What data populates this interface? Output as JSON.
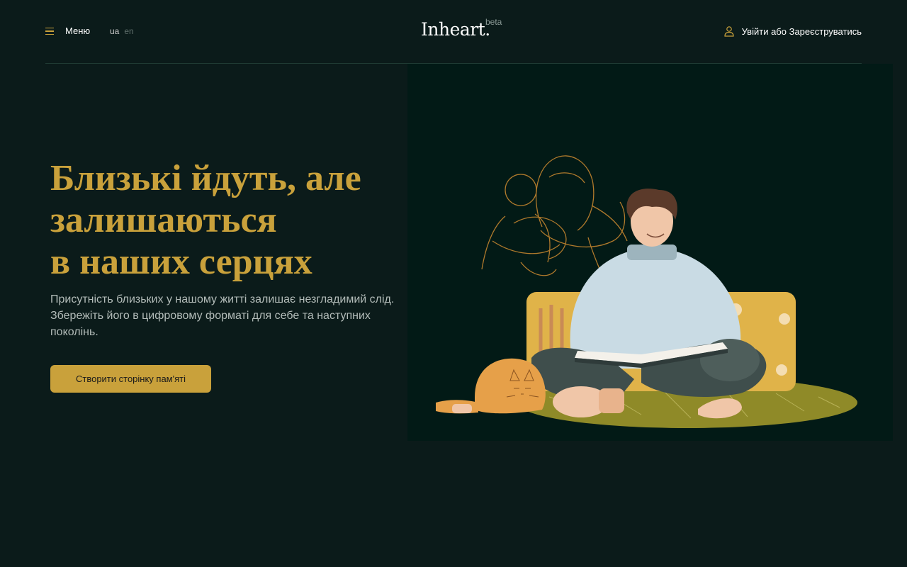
{
  "header": {
    "menu_label": "Меню",
    "lang_active": "ua",
    "lang_other": "en",
    "logo": "Inheart.",
    "beta": "beta",
    "auth_label": "Увійти або Зареєструватись"
  },
  "hero": {
    "title_lines": [
      "Близькі йдуть, але",
      "залишаються",
      "в наших серцях"
    ],
    "description": "Присутність близьких у нашому житті залишає незгладимий слід. Збережіть його в цифровому форматі для себе та наступних поколінь.",
    "cta_label": "Створити сторінку пам'яті"
  },
  "colors": {
    "background": "#0b1b1a",
    "accent": "#c9a13b",
    "illustration_bg": "#021a16"
  },
  "icons": [
    "burger-menu-icon",
    "user-icon"
  ]
}
